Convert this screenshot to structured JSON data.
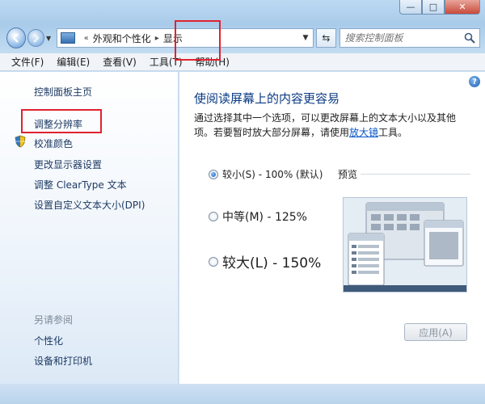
{
  "window": {
    "controls": {
      "minimize": "—",
      "maximize": "□",
      "close": "✕"
    }
  },
  "address": {
    "prefix": "«",
    "crumbs": [
      "外观和个性化",
      "显示"
    ],
    "separator": "▸"
  },
  "search": {
    "placeholder": "搜索控制面板"
  },
  "menu": [
    "文件(F)",
    "编辑(E)",
    "查看(V)",
    "工具(T)",
    "帮助(H)"
  ],
  "sidebar": {
    "links": [
      "控制面板主页",
      "调整分辨率",
      "校准颜色",
      "更改显示器设置",
      "调整 ClearType 文本",
      "设置自定义文本大小(DPI)"
    ],
    "see_also_heading": "另请参阅",
    "see_also": [
      "个性化",
      "设备和打印机"
    ]
  },
  "main": {
    "title": "使阅读屏幕上的内容更容易",
    "description_pre": "通过选择其中一个选项，可以更改屏幕上的文本大小以及其他项。若要暂时放大部分屏幕，请使用",
    "description_link": "放大镜",
    "description_post": "工具。",
    "options": [
      {
        "label": "较小(S) - 100% (默认)",
        "selected": true
      },
      {
        "label": "中等(M) - 125%",
        "selected": false
      },
      {
        "label": "较大(L) - 150%",
        "selected": false
      }
    ],
    "preview_label": "预览",
    "apply_label": "应用(A)",
    "help": "?"
  },
  "colors": {
    "highlight": "#e0232f",
    "title_blue": "#0a3a84",
    "link_blue": "#0b56c8"
  }
}
